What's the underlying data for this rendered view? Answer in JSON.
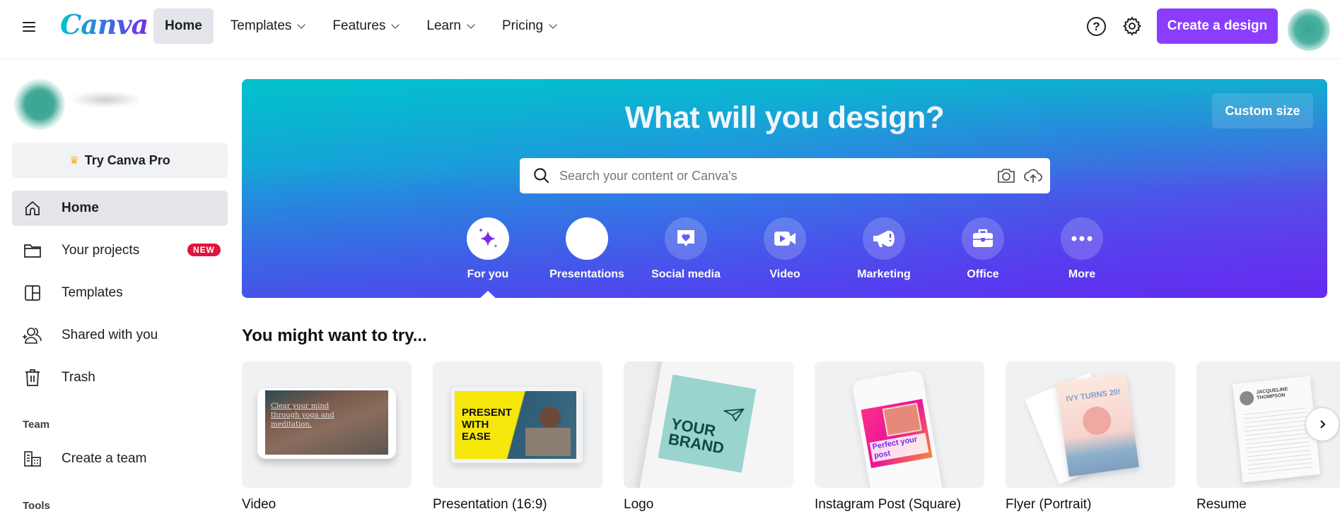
{
  "header": {
    "logo": "Canva",
    "nav": [
      {
        "label": "Home",
        "active": true,
        "dropdown": false
      },
      {
        "label": "Templates",
        "active": false,
        "dropdown": true
      },
      {
        "label": "Features",
        "active": false,
        "dropdown": true
      },
      {
        "label": "Learn",
        "active": false,
        "dropdown": true
      },
      {
        "label": "Pricing",
        "active": false,
        "dropdown": true
      }
    ],
    "help_icon": "?",
    "create_button": "Create a design"
  },
  "sidebar": {
    "try_pro": "Try Canva Pro",
    "items": [
      {
        "label": "Home",
        "icon": "home-icon",
        "active": true
      },
      {
        "label": "Your projects",
        "icon": "folder-icon",
        "badge": "NEW"
      },
      {
        "label": "Templates",
        "icon": "templates-icon"
      },
      {
        "label": "Shared with you",
        "icon": "shared-users-icon"
      },
      {
        "label": "Trash",
        "icon": "trash-icon"
      }
    ],
    "team_heading": "Team",
    "team_items": [
      {
        "label": "Create a team",
        "icon": "building-icon"
      }
    ],
    "tools_heading": "Tools"
  },
  "banner": {
    "title": "What will you design?",
    "custom_size": "Custom size",
    "search_placeholder": "Search your content or Canva's",
    "categories": [
      {
        "label": "For you",
        "icon": "sparkle-icon",
        "selected": true
      },
      {
        "label": "Presentations",
        "icon": "presentation-icon"
      },
      {
        "label": "Social media",
        "icon": "heart-message-icon"
      },
      {
        "label": "Video",
        "icon": "video-camera-icon"
      },
      {
        "label": "Marketing",
        "icon": "megaphone-icon"
      },
      {
        "label": "Office",
        "icon": "briefcase-icon"
      },
      {
        "label": "More",
        "icon": "more-dots-icon"
      }
    ]
  },
  "suggestions": {
    "title": "You might want to try...",
    "cards": [
      {
        "label": "Video",
        "thumb_text": "Clear your mind through yoga and meditation."
      },
      {
        "label": "Presentation (16:9)",
        "thumb_text": "PRESENT WITH EASE"
      },
      {
        "label": "Logo",
        "thumb_text": "YOUR BRAND"
      },
      {
        "label": "Instagram Post (Square)",
        "thumb_text": "Perfect your post"
      },
      {
        "label": "Flyer (Portrait)",
        "thumb_text": "IVY TURNS 20!"
      },
      {
        "label": "Resume",
        "thumb_text": "JACQUELINE THOMPSON"
      }
    ]
  },
  "colors": {
    "accent": "#8b3dff",
    "badge": "#e0143c",
    "banner_start": "#00c4cc",
    "banner_end": "#7d2ae8"
  }
}
